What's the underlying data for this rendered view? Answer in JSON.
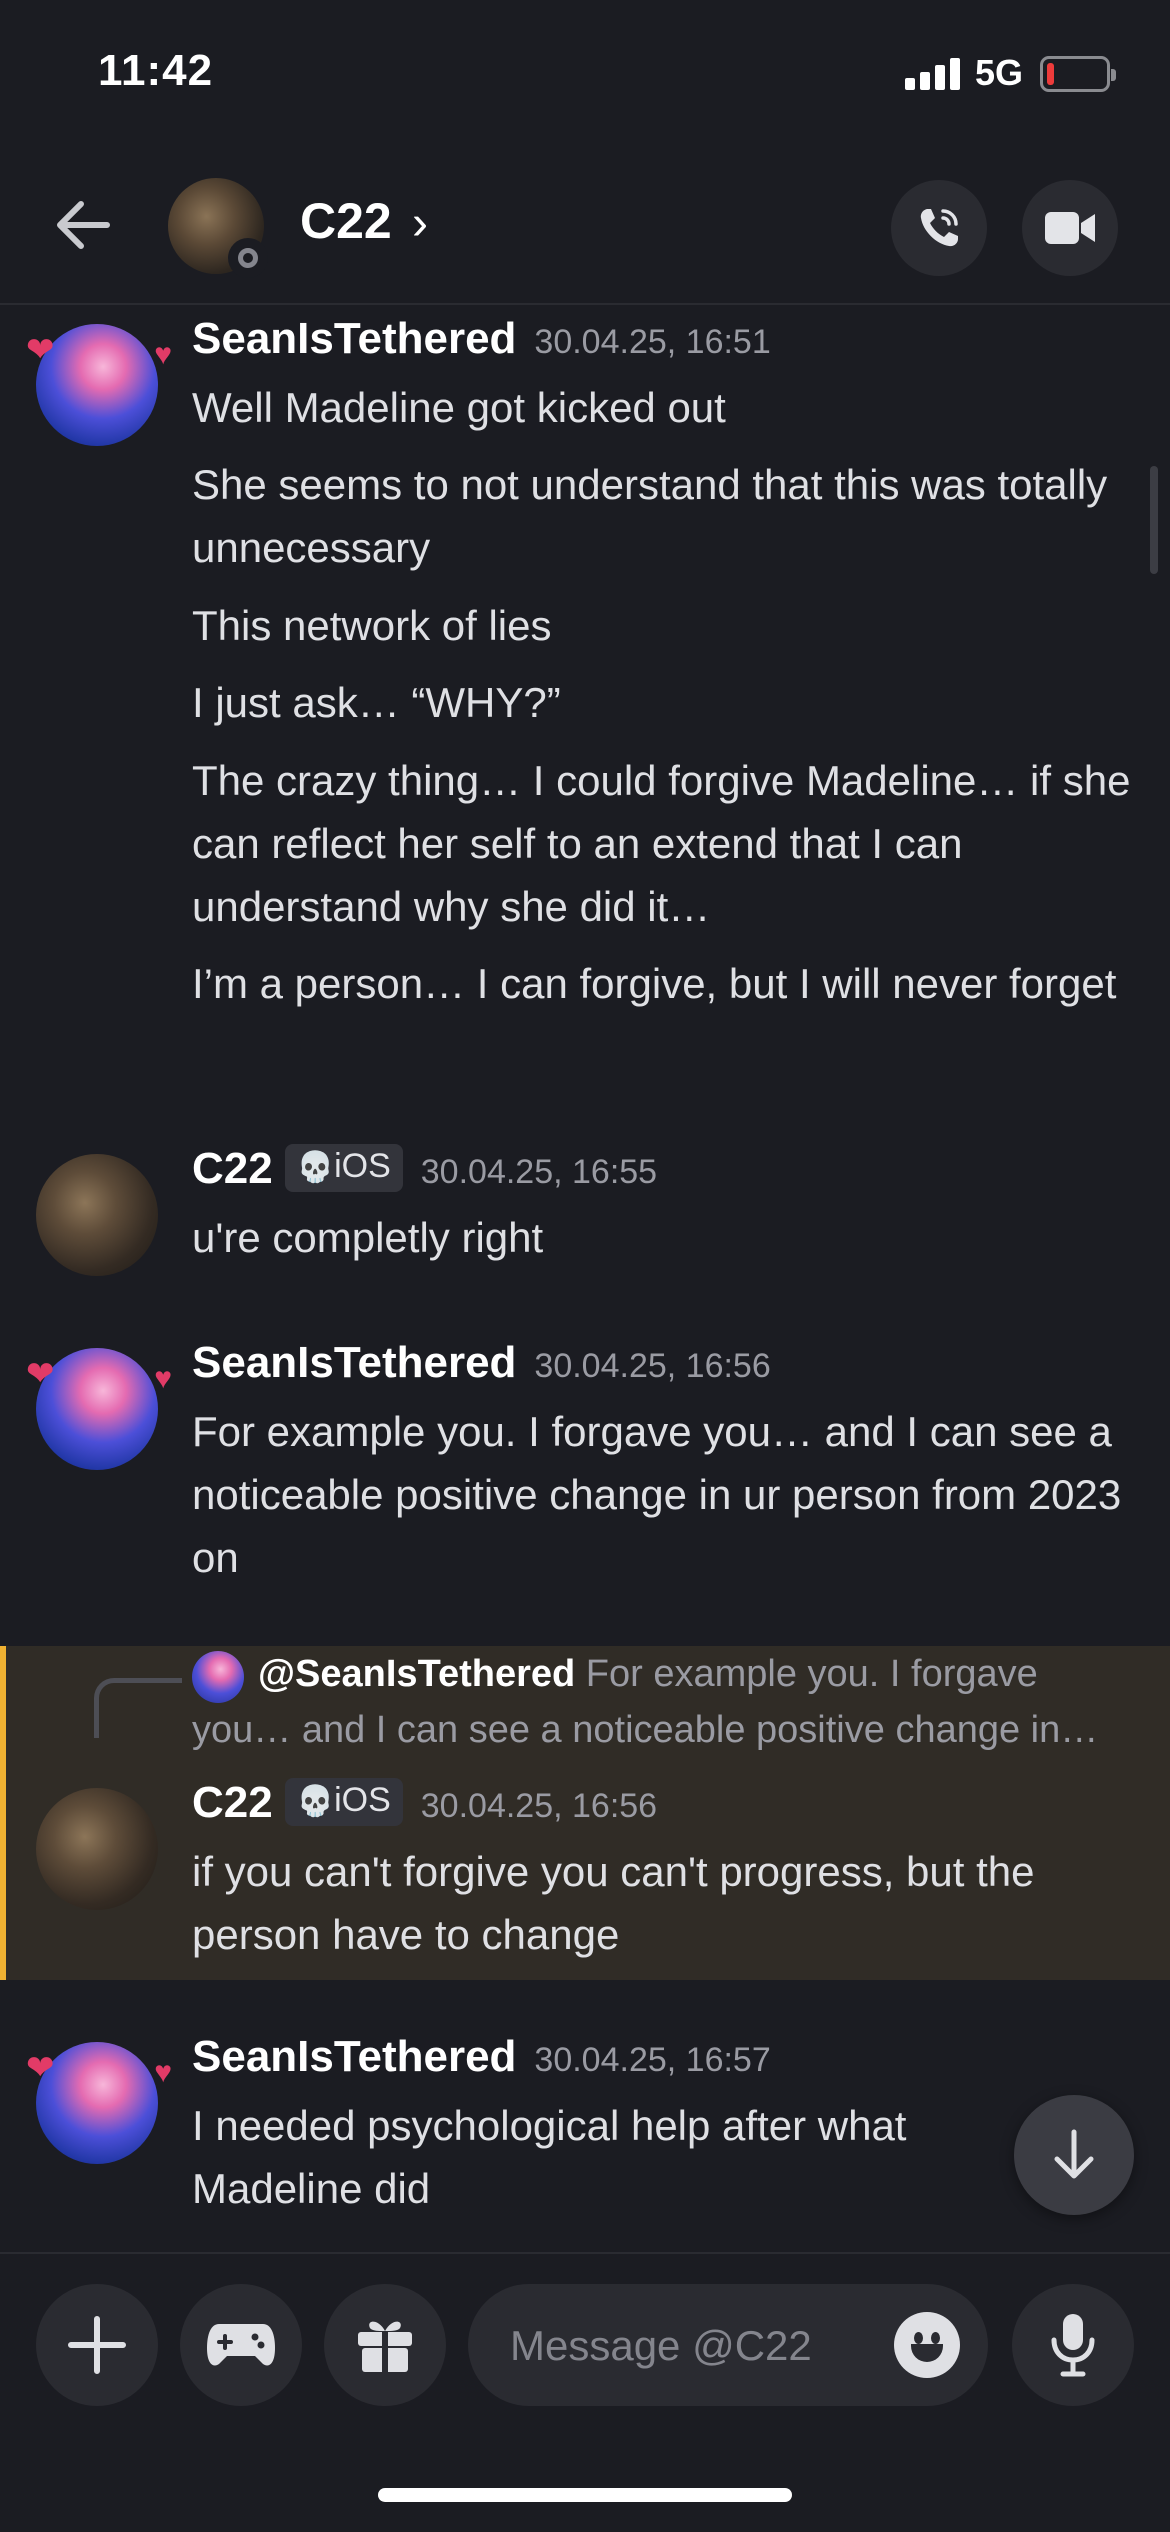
{
  "status_bar": {
    "time": "11:42",
    "network": "5G"
  },
  "header": {
    "title": "C22",
    "chevron": "›"
  },
  "icons": {
    "back": "arrow-left-icon",
    "call": "phone-icon",
    "video": "video-camera-icon",
    "jump": "arrow-down-icon",
    "add": "plus-icon",
    "games": "gamepad-icon",
    "gift": "gift-icon",
    "emoji": "emoji-icon",
    "mic": "microphone-icon"
  },
  "colors": {
    "background": "#1b1c22",
    "highlight": "#302c26",
    "highlight_bar": "#f0b232",
    "surface": "#2a2b31"
  },
  "messages": [
    {
      "author": "SeanIsTethered",
      "timestamp": "30.04.25, 16:51",
      "lines": [
        "Well Madeline got kicked out",
        "She seems to not understand that this was totally unnecessary",
        "This network of lies",
        "I just ask… “WHY?”",
        "The crazy thing… I could forgive Madeline… if she can reflect her self to an extend that I can understand why she did it…",
        "I’m a person… I can forgive, but I will never forget"
      ]
    },
    {
      "author": "C22",
      "tag": "iOS",
      "tag_icon": "💀",
      "timestamp": "30.04.25, 16:55",
      "lines": [
        "u're completly right"
      ]
    },
    {
      "author": "SeanIsTethered",
      "timestamp": "30.04.25, 16:56",
      "lines": [
        "For example you. I forgave you… and I can see a noticeable positive change in ur person from 2023 on"
      ]
    },
    {
      "author": "C22",
      "tag": "iOS",
      "tag_icon": "💀",
      "timestamp": "30.04.25, 16:56",
      "reply": {
        "author": "@SeanIsTethered",
        "text": "For example you. I forgave you… and I can see a noticeable positive change in…"
      },
      "lines": [
        "if you can't forgive you can't progress, but the person have to change"
      ]
    },
    {
      "author": "SeanIsTethered",
      "timestamp": "30.04.25, 16:57",
      "lines": [
        "I needed psychological help after what Madeline did"
      ]
    }
  ],
  "composer": {
    "placeholder": "Message @C22"
  }
}
